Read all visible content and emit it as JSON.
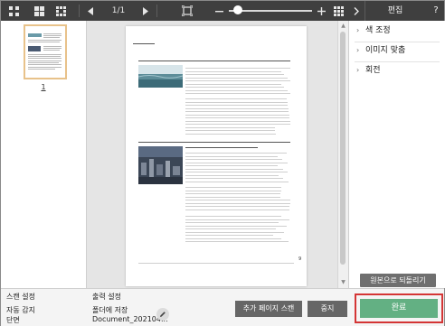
{
  "toolbar": {
    "page_counter": "1/1",
    "icons": [
      "grid-small-icon",
      "grid-large-icon",
      "arrow-left-icon",
      "arrow-right-icon",
      "fit-page-icon",
      "zoom-out-icon",
      "zoom-slider",
      "zoom-in-icon",
      "grid-view-icon"
    ]
  },
  "right_header": {
    "title": "편집",
    "help": "?"
  },
  "thumbnails": [
    {
      "number": "1"
    }
  ],
  "right_panel": {
    "sections": [
      {
        "label": "색 조정"
      },
      {
        "label": "이미지 맞춤"
      },
      {
        "label": "회전"
      }
    ],
    "restore_button": "원본으로 되돌리기"
  },
  "bottom": {
    "scan_settings": {
      "title": "스캔 설정",
      "line1": "자동 감지",
      "line2": "단면"
    },
    "output_settings": {
      "title": "출력 설정",
      "line1": "폴더에 저장",
      "line2": "Document_202104..."
    },
    "add_page_scan_button": "추가 페이지 스캔",
    "stop_button": "중지",
    "done_button": "완료"
  },
  "colors": {
    "toolbar_bg": "#3f3f3f",
    "done_green": "#63b083",
    "highlight_red": "#d43535",
    "dark_button": "#666666"
  }
}
